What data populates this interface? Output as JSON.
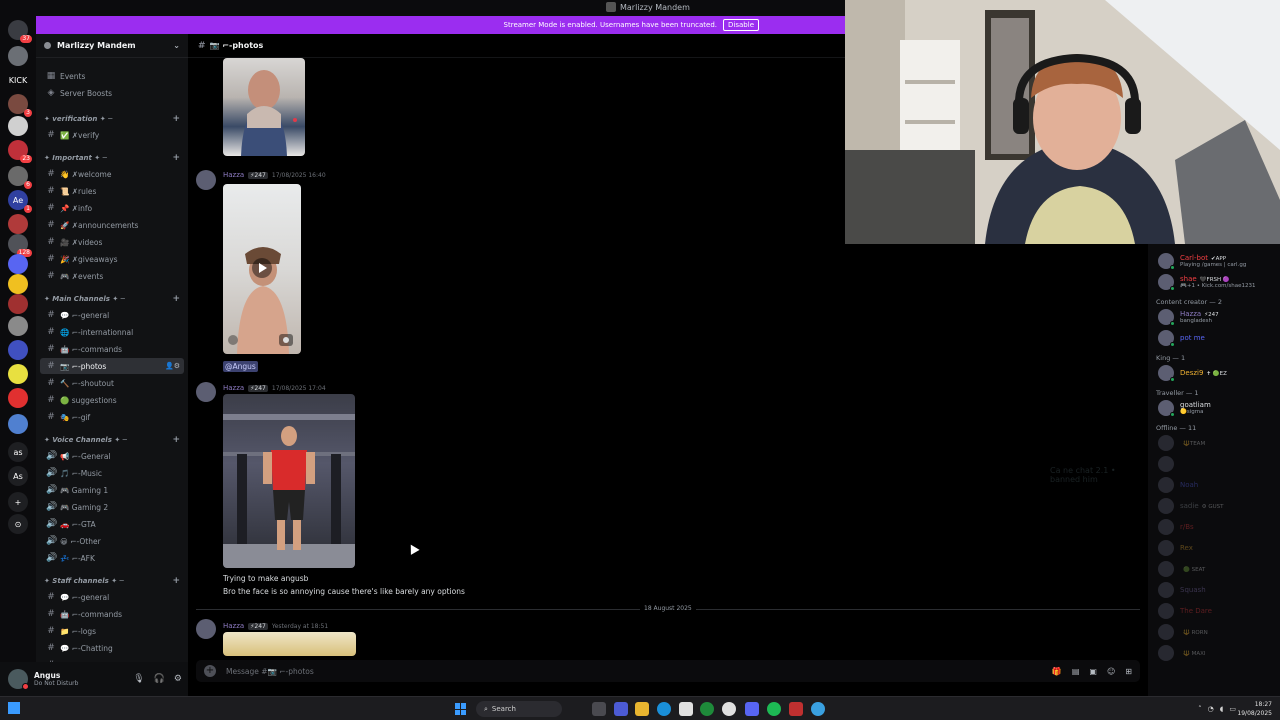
{
  "titlebar": {
    "title": "Marlizzy Mandem"
  },
  "banner": {
    "text": "Streamer Mode is enabled. Usernames have been truncated.",
    "button": "Disable"
  },
  "server_rail": [
    {
      "label": "",
      "badge": "37",
      "color": "#3a3c42"
    },
    {
      "label": "",
      "badge": "",
      "color": "#6b6f75"
    },
    {
      "label": "KICK",
      "badge": "",
      "color": "#0b0b0d"
    },
    {
      "label": "",
      "badge": "3",
      "color": "#7a4a40"
    },
    {
      "label": "",
      "badge": "",
      "color": "#d0d0d0"
    },
    {
      "label": "",
      "badge": "23",
      "color": "#c0303a"
    },
    {
      "label": "",
      "badge": "6",
      "color": "#6a6a6a"
    },
    {
      "label": "Ae",
      "badge": "1",
      "color": "#3040a0"
    },
    {
      "label": "",
      "badge": "",
      "color": "#b03a3a"
    },
    {
      "label": "",
      "badge": "128",
      "color": "#505258"
    },
    {
      "label": "",
      "badge": "",
      "color": "#5865f2"
    },
    {
      "label": "",
      "badge": "",
      "color": "#f0c020"
    },
    {
      "label": "",
      "badge": "",
      "color": "#a03030"
    },
    {
      "label": "",
      "badge": "",
      "color": "#8a8a8a"
    },
    {
      "label": "",
      "badge": "",
      "color": "#4050c0"
    },
    {
      "label": "",
      "badge": "",
      "color": "#e8e040"
    },
    {
      "label": "",
      "badge": "",
      "color": "#e03030"
    },
    {
      "label": "",
      "badge": "",
      "color": "#5080d0"
    },
    {
      "label": "as",
      "badge": "",
      "color": "#1e1f22"
    },
    {
      "label": "As",
      "badge": "",
      "color": "#1e1f22"
    },
    {
      "label": "+",
      "badge": "",
      "color": "#1e1f22"
    },
    {
      "label": "⊙",
      "badge": "",
      "color": "#1e1f22"
    }
  ],
  "sidebar": {
    "guild_name": "Marlizzy Mandem",
    "top_items": [
      "Events",
      "Server Boosts"
    ],
    "categories": [
      {
        "name": "✦ verification ✦ ─",
        "channels": [
          "✅ ✗verify"
        ]
      },
      {
        "name": "✦ Important ✦ ─",
        "channels": [
          "👋 ✗welcome",
          "📜 ✗rules",
          "📌 ✗info",
          "🚀 ✗announcements",
          "🎥 ✗videos",
          "🎉 ✗giveaways",
          "🎮 ✗events"
        ]
      },
      {
        "name": "✦ Main Channels ✦ ─",
        "channels": [
          "💬 ⌐-general",
          "🌐 ⌐-internationnal",
          "🤖 ⌐-commands",
          "📷 ⌐-photos",
          "🔨 ⌐-shoutout",
          "🟢 suggestions",
          "🎭 ⌐-gif"
        ]
      },
      {
        "name": "✦ Voice Channels ✦ ─",
        "channels": [
          "📢 ⌐-General",
          "🎵 ⌐-Music",
          "🎮 Gaming 1",
          "🎮 Gaming 2",
          "🚗 ⌐-GTA",
          "😀 ⌐-Other",
          "💤 ⌐-AFK"
        ]
      },
      {
        "name": "✦ Staff channels ✦ ─",
        "channels": [
          "💬 ⌐-general",
          "🤖 ⌐-commands",
          "📁 ⌐-logs",
          "💬 ⌐-Chatting",
          "😊 ⌐-Meeting"
        ]
      }
    ]
  },
  "user": {
    "name": "Angus",
    "status": "Do Not Disturb"
  },
  "chat": {
    "channel": "📷 ⌐-photos",
    "messages": [
      {
        "author": "Hazza",
        "tag": "⚡247",
        "time": "17/08/2025 16:40"
      },
      {
        "mention": "@Angus"
      },
      {
        "author": "Hazza",
        "tag": "⚡247",
        "time": "17/08/2025 17:04",
        "lines": [
          "Trying to make angusb",
          "Bro the face is so annoying cause there's like barely any options"
        ]
      },
      {
        "author": "Hazza",
        "tag": "⚡247",
        "time": "Yesterday at 18:51"
      }
    ],
    "date_divider": "18 August 2025",
    "composer_placeholder": "Message #📷 ⌐-photos",
    "ghost_text": "Ca ne chat 2.1 • banned him"
  },
  "members": {
    "bots": [
      {
        "name": "Carl-bot",
        "tag": "✔APP",
        "sub": "Playing /games | carl.gg",
        "color": "#f23f43"
      },
      {
        "name": "shae",
        "tag": "🖤FRSH 🟣",
        "sub": "🎮+1 • Kick.com/shae1231",
        "color": "#f23f43"
      }
    ],
    "groups": [
      {
        "label": "Content creator — 2",
        "members": [
          {
            "name": "Hazza",
            "tag": "⚡247",
            "sub": "bangladesh",
            "color": "#8e7cc3"
          },
          {
            "name": "pot me",
            "tag": "",
            "sub": "",
            "color": "#5865f2"
          }
        ]
      },
      {
        "label": "King — 1",
        "members": [
          {
            "name": "Deszi9",
            "tag": "✝ 🟢EZ",
            "sub": "",
            "color": "#f0b232"
          }
        ]
      },
      {
        "label": "Traveller — 1",
        "members": [
          {
            "name": "goatliam",
            "tag": "",
            "sub": "🟡sigma",
            "color": "#dbdee1"
          }
        ]
      },
      {
        "label": "Offline — 11",
        "members": [
          {
            "name": "",
            "tag": "🔱TEAM",
            "sub": "",
            "color": "#949ba4"
          },
          {
            "name": "",
            "tag": "",
            "sub": "",
            "color": "#f23f43"
          },
          {
            "name": "Noah",
            "tag": "",
            "sub": "",
            "color": "#5865f2"
          },
          {
            "name": "sadie",
            "tag": "⚙ GUST",
            "sub": "",
            "color": "#949ba4"
          },
          {
            "name": "r/Bs",
            "tag": "",
            "sub": "",
            "color": "#f23f43"
          },
          {
            "name": "Rex",
            "tag": "",
            "sub": "",
            "color": "#f0b232"
          },
          {
            "name": "",
            "tag": "🟢 SEAT",
            "sub": "",
            "color": "#949ba4"
          },
          {
            "name": "Squash",
            "tag": "",
            "sub": "",
            "color": "#8e7cc3"
          },
          {
            "name": "The Dare",
            "tag": "",
            "sub": "",
            "color": "#f23f43"
          },
          {
            "name": "",
            "tag": "🔱 RORN",
            "sub": "",
            "color": "#949ba4"
          },
          {
            "name": "",
            "tag": "🔱 MAXI",
            "sub": "",
            "color": "#949ba4"
          }
        ]
      }
    ]
  },
  "taskbar": {
    "search": "Search",
    "time": "18:27",
    "date": "19/08/2025"
  }
}
